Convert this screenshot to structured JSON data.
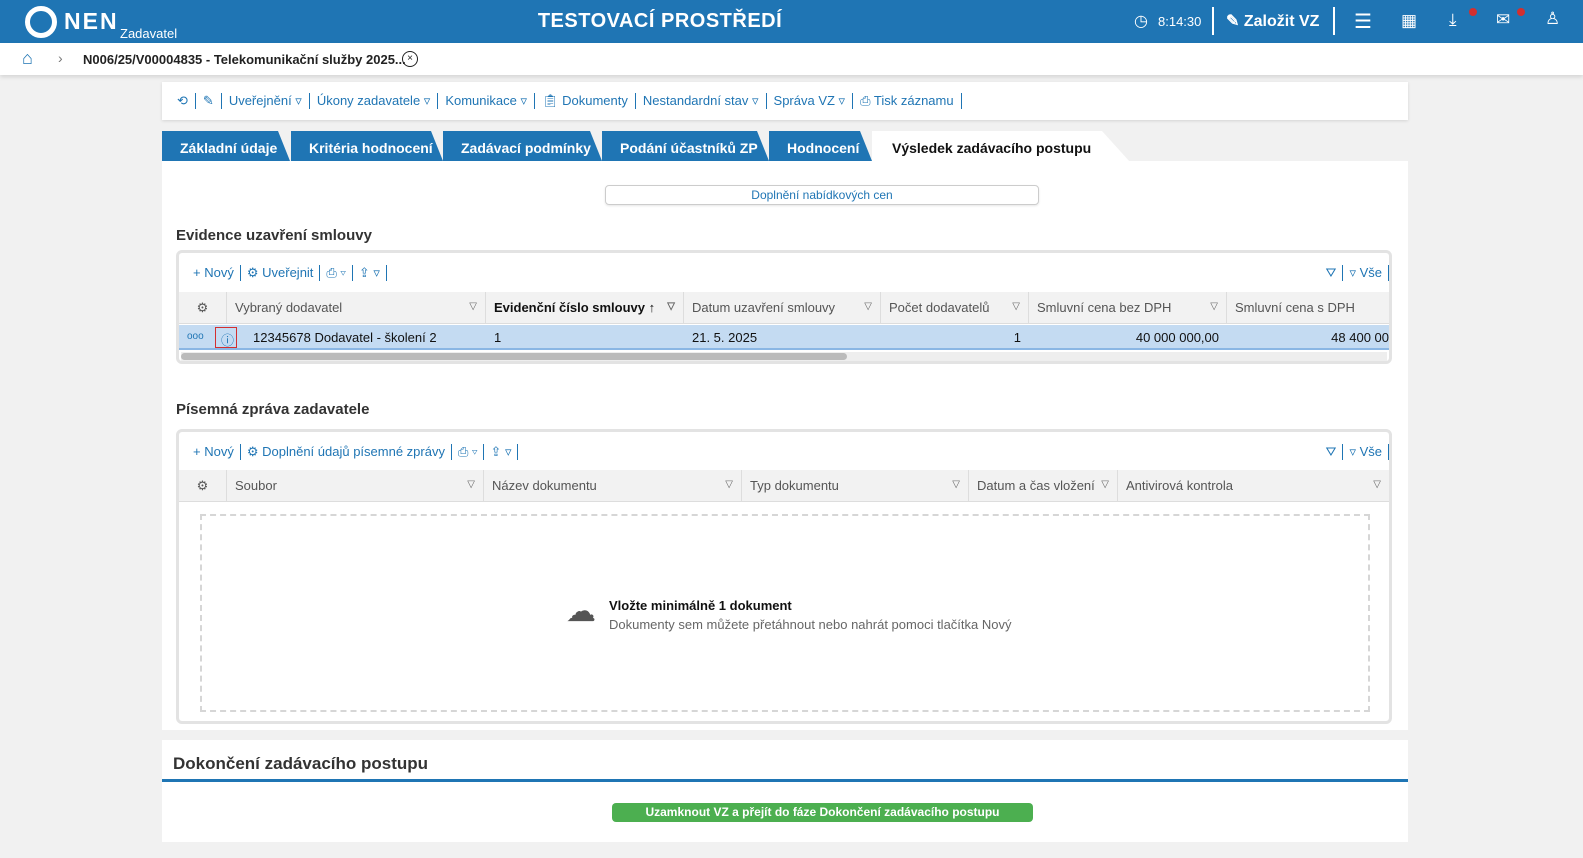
{
  "header": {
    "logo": "NEN",
    "logo_sub": "Zadavatel",
    "environment": "TESTOVACÍ PROSTŘEDÍ",
    "time": "8:14:30",
    "create_label": "Založit VZ",
    "accent": "#1f75b4"
  },
  "breadcrumb": {
    "title": "N006/25/V00004835 - Telekomunikační služby 2025..."
  },
  "toolbar": {
    "items": [
      "Uveřejnění ▿",
      "Úkony zadavatele ▿",
      "Komunikace ▿",
      "Dokumenty",
      "Nestandardní stav ▿",
      "Správa VZ ▿",
      "Tisk záznamu"
    ]
  },
  "tabs": [
    "Základní údaje",
    "Kritéria hodnocení",
    "Zadávací podmínky",
    "Podání účastníků ZP",
    "Hodnocení",
    "Výsledek zadávacího postupu"
  ],
  "doplneni_button": "Doplnění nabídkových cen",
  "contracts": {
    "title": "Evidence uzavření smlouvy",
    "toolbar": {
      "new": "Nový",
      "publish": "Uveřejnit",
      "filter_all": "Vše"
    },
    "columns": [
      "Vybraný dodavatel",
      "Evidenční číslo smlouvy",
      "Datum uzavření smlouvy",
      "Počet dodavatelů",
      "Smluvní cena bez DPH",
      "Smluvní cena s DPH"
    ],
    "rows": [
      {
        "supplier": "12345678 Dodavatel - školení 2",
        "number": "1",
        "date": "21. 5. 2025",
        "count": "1",
        "price_no_vat": "40 000 000,00",
        "price_vat": "48 400 00"
      }
    ]
  },
  "report": {
    "title": "Písemná zpráva zadavatele",
    "toolbar": {
      "new": "Nový",
      "complete": "Doplnění údajů písemné zprávy",
      "filter_all": "Vše"
    },
    "columns": [
      "Soubor",
      "Název dokumentu",
      "Typ dokumentu",
      "Datum a čas vložení",
      "Antivirová kontrola"
    ],
    "empty_title": "Vložte minimálně 1 dokument",
    "empty_text": "Dokumenty sem můžete přetáhnout nebo nahrát pomoci tlačítka Nový"
  },
  "finish": {
    "title": "Dokončení zadávacího postupu",
    "button": "Uzamknout VZ a přejít do fáze Dokončení zadávacího postupu",
    "button_color": "#4caf50"
  }
}
